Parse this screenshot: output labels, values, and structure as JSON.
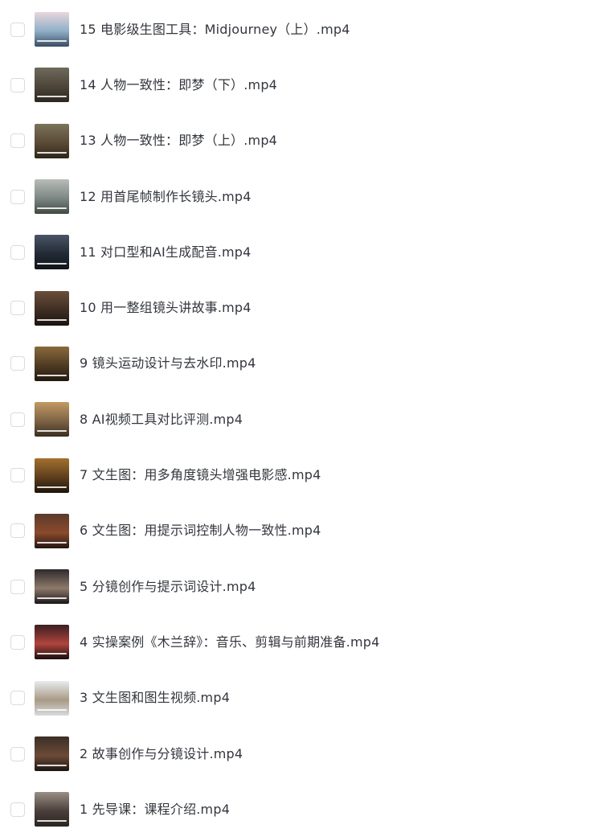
{
  "files": [
    {
      "name": "15 电影级生图工具：Midjourney（上）.mp4",
      "thumb": {
        "top": "#e9d6dc",
        "mid": "#8fb0c8",
        "bottom": "#3b4c63",
        "icon": "video-thumbnail-icon"
      }
    },
    {
      "name": "14 人物一致性：即梦（下）.mp4",
      "thumb": {
        "top": "#6d6a5c",
        "mid": "#4d4538",
        "bottom": "#2c2620",
        "icon": "video-thumbnail-icon"
      }
    },
    {
      "name": "13 人物一致性：即梦（上）.mp4",
      "thumb": {
        "top": "#7b735d",
        "mid": "#5a4a35",
        "bottom": "#2d2519",
        "icon": "video-thumbnail-icon"
      }
    },
    {
      "name": "12 用首尾帧制作长镜头.mp4",
      "thumb": {
        "top": "#b7bcb8",
        "mid": "#7c8784",
        "bottom": "#414842",
        "icon": "video-thumbnail-icon"
      }
    },
    {
      "name": "11 对口型和AI生成配音.mp4",
      "thumb": {
        "top": "#4a5566",
        "mid": "#222a35",
        "bottom": "#101418",
        "icon": "video-thumbnail-icon"
      }
    },
    {
      "name": "10 用一整组镜头讲故事.mp4",
      "thumb": {
        "top": "#6b4f3b",
        "mid": "#3e2d22",
        "bottom": "#1a1410",
        "icon": "video-thumbnail-icon"
      }
    },
    {
      "name": "9 镜头运动设计与去水印.mp4",
      "thumb": {
        "top": "#8a6a3c",
        "mid": "#4f3b22",
        "bottom": "#1f170e",
        "icon": "video-thumbnail-icon"
      }
    },
    {
      "name": "8 AI视频工具对比评测.mp4",
      "thumb": {
        "top": "#c29a63",
        "mid": "#7d6345",
        "bottom": "#3b2e20",
        "icon": "video-thumbnail-icon"
      }
    },
    {
      "name": "7 文生图：用多角度镜头增强电影感.mp4",
      "thumb": {
        "top": "#a3702f",
        "mid": "#5e3e1d",
        "bottom": "#1d140b",
        "icon": "video-thumbnail-icon"
      }
    },
    {
      "name": "6 文生图：用提示词控制人物一致性.mp4",
      "thumb": {
        "top": "#5b3a2a",
        "mid": "#8a4a2c",
        "bottom": "#221511",
        "icon": "video-thumbnail-icon"
      }
    },
    {
      "name": "5 分镜创作与提示词设计.mp4",
      "thumb": {
        "top": "#2d2a2b",
        "mid": "#8e7a6b",
        "bottom": "#1a1718",
        "icon": "video-thumbnail-icon"
      }
    },
    {
      "name": "4 实操案例《木兰辞》：音乐、剪辑与前期准备.mp4",
      "thumb": {
        "top": "#3a1f20",
        "mid": "#b0443d",
        "bottom": "#1a0e0e",
        "icon": "video-thumbnail-icon"
      }
    },
    {
      "name": "3 文生图和图生视频.mp4",
      "thumb": {
        "top": "#e9ebee",
        "mid": "#a89a85",
        "bottom": "#d8dadd",
        "icon": "video-thumbnail-icon"
      }
    },
    {
      "name": "2 故事创作与分镜设计.mp4",
      "thumb": {
        "top": "#3b2e27",
        "mid": "#6c4b37",
        "bottom": "#1c1511",
        "icon": "video-thumbnail-icon"
      }
    },
    {
      "name": "1 先导课：课程介绍.mp4",
      "thumb": {
        "top": "#9a8f86",
        "mid": "#4a3f3a",
        "bottom": "#2a2320",
        "icon": "video-thumbnail-icon"
      }
    }
  ]
}
